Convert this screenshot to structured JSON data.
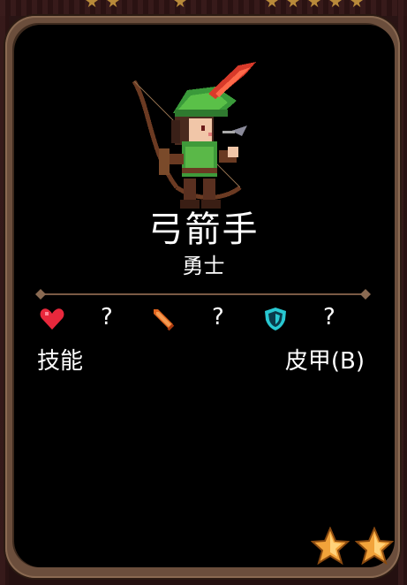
{
  "hero": {
    "name": "弓箭手",
    "rank": "勇士",
    "portrait_icon": "archer-sprite"
  },
  "stats": {
    "health": {
      "icon": "heart-icon",
      "value": "?",
      "color": "#e8283c"
    },
    "attack": {
      "icon": "sword-icon",
      "value": "?",
      "color": "#e0641e"
    },
    "defense": {
      "icon": "shield-icon",
      "value": "?",
      "color": "#28c8d2"
    }
  },
  "labels": {
    "skills": "技能",
    "armor": "皮甲(B)"
  },
  "rarity": {
    "stars": 2,
    "star_color": "#f2a33a"
  },
  "colors": {
    "card_frame": "#6b4e3c",
    "card_bg": "#000000",
    "divider": "#7a5a44"
  }
}
